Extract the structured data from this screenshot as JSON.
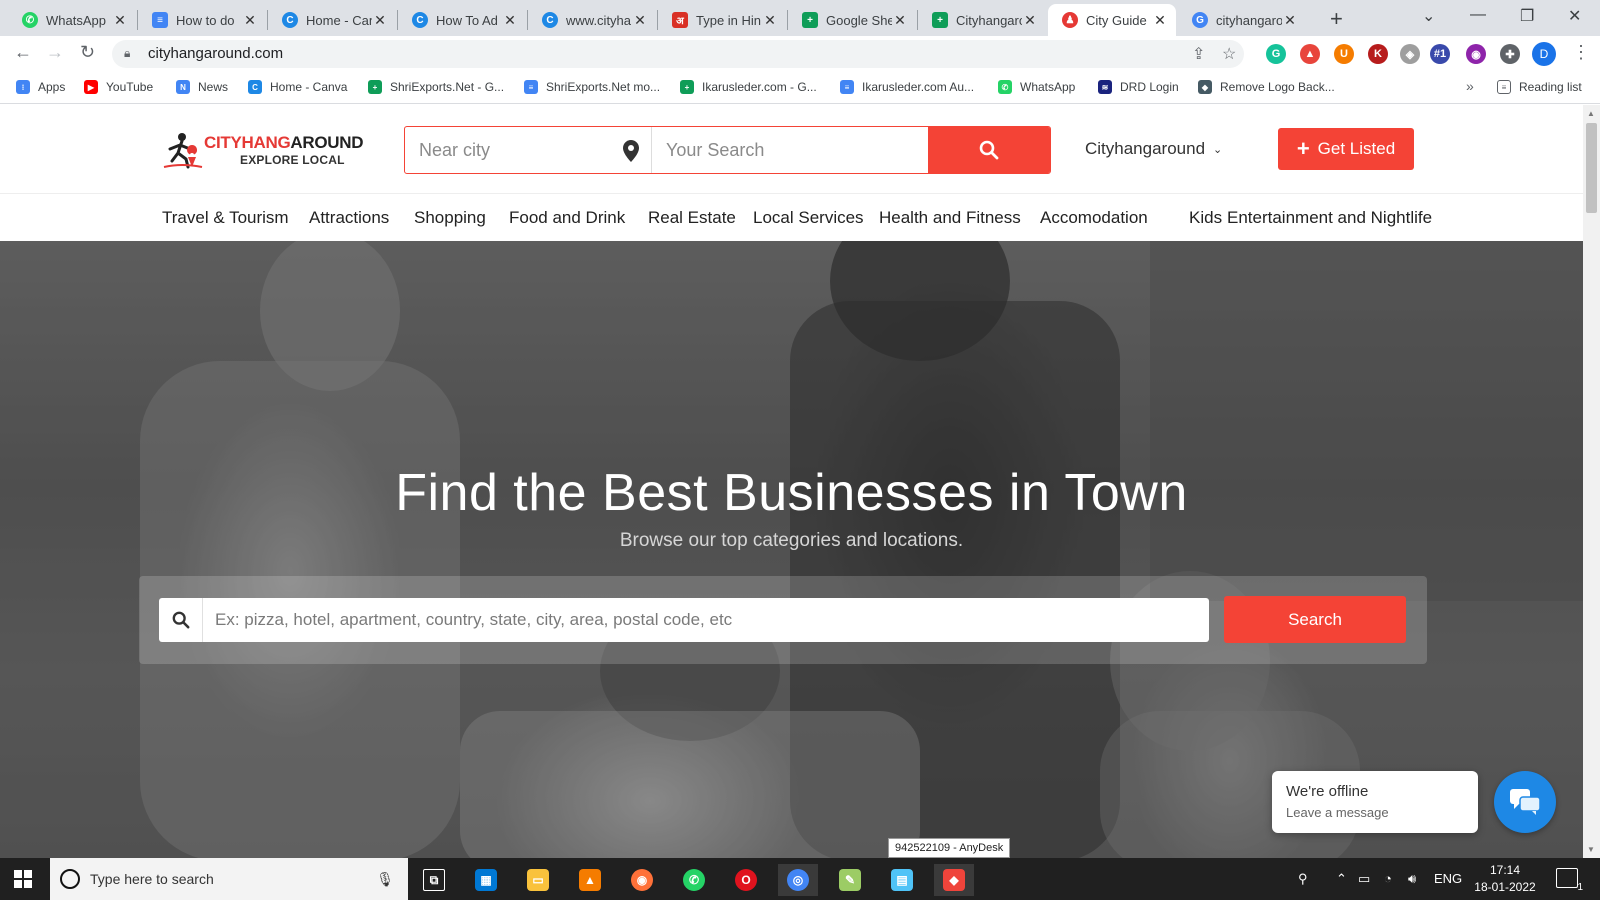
{
  "browser": {
    "tabs": [
      {
        "label": "WhatsApp",
        "icon": "whatsapp-icon",
        "color": "#25d366"
      },
      {
        "label": "How to do",
        "icon": "docs-icon",
        "color": "#4285f4"
      },
      {
        "label": "Home - Can",
        "icon": "canva-icon",
        "color": "#1e88e5"
      },
      {
        "label": "How To Ad",
        "icon": "canva-icon",
        "color": "#1e88e5"
      },
      {
        "label": "www.cityha",
        "icon": "canva-icon",
        "color": "#1e88e5"
      },
      {
        "label": "Type in Hin",
        "icon": "hindi-icon",
        "color": "#d93025"
      },
      {
        "label": "Google She",
        "icon": "sheets-icon",
        "color": "#0f9d58"
      },
      {
        "label": "Cityhangaro",
        "icon": "sheets-icon",
        "color": "#0f9d58"
      },
      {
        "label": "City Guide",
        "icon": "cityhangaround-icon",
        "color": "#e53935",
        "active": true
      },
      {
        "label": "cityhangaro",
        "icon": "google-icon",
        "color": "#4285f4"
      }
    ],
    "url": "cityhangaround.com",
    "extensions": [
      {
        "name": "grammarly-icon",
        "text": "G",
        "color": "#15c39a"
      },
      {
        "name": "drive-ext-icon",
        "text": "▲",
        "color": "#e8453c"
      },
      {
        "name": "ublock-icon",
        "text": "U",
        "color": "#f57c00"
      },
      {
        "name": "k-ext-icon",
        "text": "K",
        "color": "#b71c1c"
      },
      {
        "name": "shield-ext-icon",
        "text": "◈",
        "color": "#9e9e9e"
      },
      {
        "name": "rank-ext-icon",
        "text": "#1",
        "color": "#3949ab"
      },
      {
        "name": "color-ext-icon",
        "text": "◉",
        "color": "#8e24aa"
      },
      {
        "name": "puzzle-icon",
        "text": "✚",
        "color": "#5f6368"
      }
    ],
    "profile_initial": "D",
    "bookmarks": [
      {
        "label": "Apps",
        "icon": "apps-grid-icon",
        "color": "#4285f4"
      },
      {
        "label": "YouTube",
        "icon": "youtube-icon",
        "color": "#ff0000"
      },
      {
        "label": "News",
        "icon": "news-icon",
        "color": "#4285f4"
      },
      {
        "label": "Home - Canva",
        "icon": "canva-icon",
        "color": "#1e88e5"
      },
      {
        "label": "ShriExports.Net - G...",
        "icon": "sheets-icon",
        "color": "#0f9d58"
      },
      {
        "label": "ShriExports.Net mo...",
        "icon": "docs-icon",
        "color": "#4285f4"
      },
      {
        "label": "Ikarusleder.com - G...",
        "icon": "sheets-icon",
        "color": "#0f9d58"
      },
      {
        "label": "Ikarusleder.com Au...",
        "icon": "docs-icon",
        "color": "#4285f4"
      },
      {
        "label": "WhatsApp",
        "icon": "whatsapp-icon",
        "color": "#25d366"
      },
      {
        "label": "DRD Login",
        "icon": "database-icon",
        "color": "#1a237e"
      },
      {
        "label": "Remove Logo Back...",
        "icon": "layers-icon",
        "color": "#455a64"
      }
    ],
    "bookmarks_overflow": "»",
    "reading_list": "Reading list"
  },
  "site": {
    "logo": {
      "title_red": "CITYHANG",
      "title_dark": "AROUND",
      "subtitle": "EXPLORE LOCAL"
    },
    "header_search": {
      "near_placeholder": "Near city",
      "your_placeholder": "Your Search"
    },
    "city_dropdown": "Cityhangaround",
    "get_listed": "Get Listed",
    "categories": [
      "Travel & Tourism",
      "Attractions",
      "Shopping",
      "Food and Drink",
      "Real Estate",
      "Local Services",
      "Health and Fitness",
      "Accomodation",
      "Kids",
      "Entertainment and Nightlife"
    ],
    "hero": {
      "title": "Find the Best Businesses in Town",
      "subtitle": "Browse our top categories and locations.",
      "search_placeholder": "Ex: pizza, hotel, apartment, country, state, city, area, postal code, etc",
      "search_button": "Search"
    },
    "chat": {
      "status": "We're offline",
      "prompt": "Leave a message"
    },
    "accent_color": "#f44336"
  },
  "anydesk_tooltip": "942522109 - AnyDesk",
  "taskbar": {
    "search_placeholder": "Type here to search",
    "apps": [
      {
        "name": "task-view-icon",
        "color": "#202020"
      },
      {
        "name": "store-icon",
        "color": "#0078d4"
      },
      {
        "name": "file-explorer-icon",
        "color": "#f9c23c"
      },
      {
        "name": "vlc-icon",
        "color": "#f57c00"
      },
      {
        "name": "firefox-icon",
        "color": "#ff7139"
      },
      {
        "name": "whatsapp-icon",
        "color": "#25d366"
      },
      {
        "name": "opera-icon",
        "color": "#e0131e"
      },
      {
        "name": "chrome-icon",
        "color": "#4285f4"
      },
      {
        "name": "paint-icon",
        "color": "#9ccc65"
      },
      {
        "name": "notepad-icon",
        "color": "#4fc3f7"
      },
      {
        "name": "anydesk-icon",
        "color": "#ef443b"
      }
    ],
    "language": "ENG",
    "time": "17:14",
    "date": "18-01-2022",
    "notification_count": "1"
  }
}
